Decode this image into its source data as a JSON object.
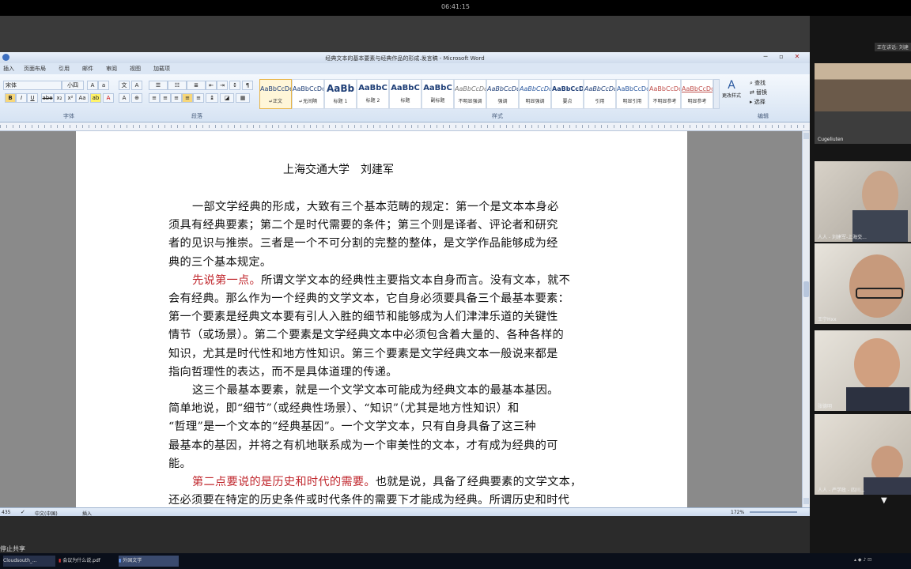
{
  "meeting": {
    "top_text": "06:41:15"
  },
  "window": {
    "title": "经典文本的基本要素与经典作品的形成.发言稿 - Microsoft Word",
    "tabs": [
      "插入",
      "页面布局",
      "引用",
      "邮件",
      "审阅",
      "视图",
      "加载项"
    ]
  },
  "ribbon": {
    "font_name": "宋体",
    "font_size": "小四",
    "group_labels": [
      "字体",
      "段落",
      "样式",
      "编辑"
    ],
    "styles": [
      {
        "sample": "AaBbCcDd",
        "name": "↵正文"
      },
      {
        "sample": "AaBbCcDd",
        "name": "↵无间隔"
      },
      {
        "sample": "AaBb",
        "name": "标题 1"
      },
      {
        "sample": "AaBbC",
        "name": "标题 2"
      },
      {
        "sample": "AaBbC",
        "name": "标题"
      },
      {
        "sample": "AaBbC",
        "name": "副标题"
      },
      {
        "sample": "AaBbCcDd",
        "name": "不明显强调"
      },
      {
        "sample": "AaBbCcDd",
        "name": "强调"
      },
      {
        "sample": "AaBbCcDd",
        "name": "明显强调"
      },
      {
        "sample": "AaBbCcDd",
        "name": "要点"
      },
      {
        "sample": "AaBbCcDd",
        "name": "引用"
      },
      {
        "sample": "AaBbCcDd",
        "name": "明显引用"
      },
      {
        "sample": "AaBbCcDd",
        "name": "不明显参考"
      },
      {
        "sample": "AaBbCcDd",
        "name": "明显参考"
      }
    ],
    "change_styles": "更改样式",
    "edit": {
      "find": "查找",
      "replace": "替换",
      "select": "选择"
    }
  },
  "document": {
    "author": "上海交通大学　刘建军",
    "lines": [
      {
        "text": "一部文学经典的形成，大致有三个基本范畴的规定：第一个是文本本身必",
        "indent": true
      },
      {
        "text": "须具有经典要素；第二个是时代需要的条件；第三个则是译者、评论者和研究",
        "indent": false
      },
      {
        "text": "者的见识与推崇。三者是一个不可分割的完整的整体，是文学作品能够成为经",
        "indent": false
      },
      {
        "text": "典的三个基本规定。",
        "indent": false
      },
      {
        "text": "所谓文学文本的经典性主要指文本自身而言。没有文本，就不",
        "indent": true,
        "red": "先说第一点。"
      },
      {
        "text": "会有经典。那么作为一个经典的文学文本，它自身必须要具备三个最基本要素：",
        "indent": false
      },
      {
        "text": "第一个要素是经典文本要有引人入胜的细节和能够成为人们津津乐道的关键性",
        "indent": false
      },
      {
        "text": "情节（或场景）。第二个要素是文学经典文本中必须包含着大量的、各种各样的",
        "indent": false
      },
      {
        "text": "知识，尤其是时代性和地方性知识。第三个要素是文学经典文本一般说来都是",
        "indent": false
      },
      {
        "text": "指向哲理性的表达，而不是具体道理的传递。",
        "indent": false
      },
      {
        "text": "这三个最基本要素，就是一个文学文本可能成为经典文本的最基本基因。",
        "indent": true
      },
      {
        "text": "简单地说，即“细节”（或经典性场景）、“知识”（尤其是地方性知识）和",
        "indent": false
      },
      {
        "text": "“哲理”是一个文本的“经典基因”。一个文学文本，只有自身具备了这三种",
        "indent": false
      },
      {
        "text": "最基本的基因，并将之有机地联系成为一个审美性的文本，才有成为经典的可",
        "indent": false
      },
      {
        "text": "能。",
        "indent": false
      },
      {
        "text": "也就是说，具备了经典要素的文学文本，",
        "indent": true,
        "red": "第二点要说的是历史和时代的需要。"
      },
      {
        "text": "还必须要在特定的历史条件或时代条件的需要下才能成为经典。所谓历史和时代",
        "indent": false
      }
    ]
  },
  "status": {
    "left": "435",
    "language": "中文(中国)",
    "mode": "插入",
    "zoom": "172%"
  },
  "participants": [
    {
      "name": "Cugeliuten"
    },
    {
      "name": "人人 - 刘建军-上海交..."
    },
    {
      "name": "王宁Hxx"
    },
    {
      "name": "张德明"
    },
    {
      "name": "人人 - 严学政 - 四川..."
    }
  ],
  "participants_header": "正在讲话: 刘建",
  "share_label": "停止共享",
  "taskbar": {
    "items": [
      "Cloudsouth_...",
      "会议为什么说.pdf",
      "外国文学"
    ]
  }
}
